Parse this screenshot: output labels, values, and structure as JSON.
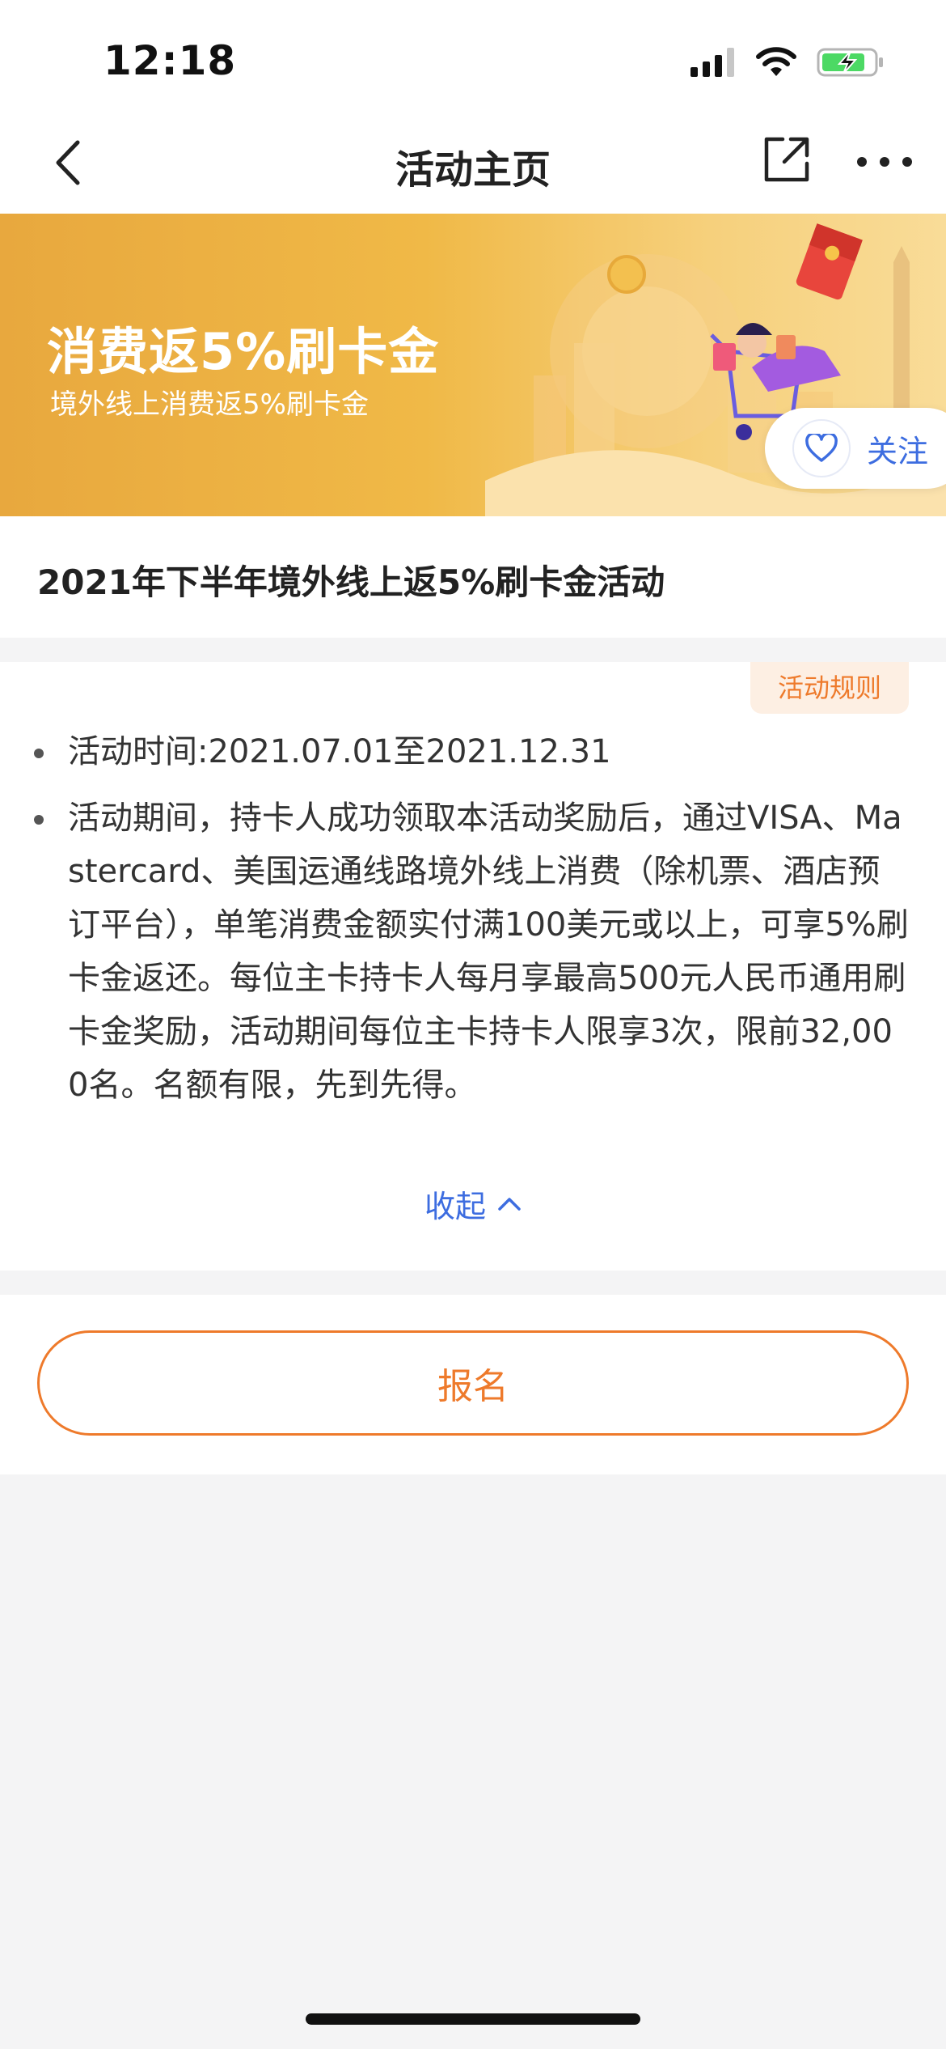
{
  "status_bar": {
    "time": "12:18",
    "icons": [
      "signal-icon",
      "wifi-icon",
      "battery-charging-icon"
    ]
  },
  "nav": {
    "title": "活动主页",
    "back_icon": "chevron-left-icon",
    "share_icon": "share-icon",
    "more_icon": "more-icon"
  },
  "banner": {
    "title": "消费返5%刷卡金",
    "subtitle": "境外线上消费返5%刷卡金",
    "follow_label": "关注",
    "colors": {
      "start": "#e8a83e",
      "end": "#f9dc98"
    }
  },
  "campaign": {
    "title": "2021年下半年境外线上返5%刷卡金活动"
  },
  "rules": {
    "badge": "活动规则",
    "items": [
      "活动时间:2021.07.01至2021.12.31",
      "活动期间，持卡人成功领取本活动奖励后，通过VISA、Mastercard、美国运通线路境外线上消费（除机票、酒店预订平台），单笔消费金额实付满100美元或以上，可享5%刷卡金返还。每位主卡持卡人每月享最高500元人民币通用刷卡金奖励，活动期间每位主卡持卡人限享3次，限前32,000名。名额有限，先到先得。"
    ],
    "collapse_label": "收起"
  },
  "signup": {
    "label": "报名"
  },
  "colors": {
    "accent_orange": "#ee7a2b",
    "link_blue": "#3d6de0",
    "page_bg": "#f4f4f5"
  }
}
